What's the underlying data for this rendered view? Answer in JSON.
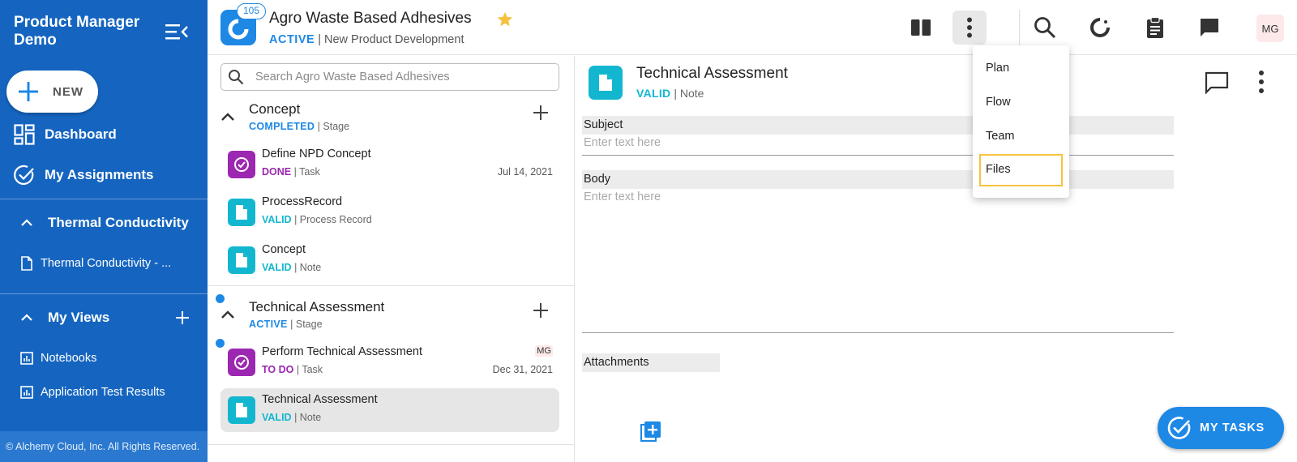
{
  "sidebar": {
    "title": "Product Manager Demo",
    "new_label": "NEW",
    "nav": [
      {
        "label": "Dashboard",
        "icon": "dashboard-icon"
      },
      {
        "label": "My Assignments",
        "icon": "check-circle-icon"
      }
    ],
    "recent_section": {
      "label": "Thermal Conductivity",
      "items": [
        {
          "label": "Thermal Conductivity - ..."
        }
      ]
    },
    "views_section": {
      "label": "My Views",
      "items": [
        {
          "label": "Notebooks"
        },
        {
          "label": "Application Test Results"
        }
      ]
    },
    "footer": "© Alchemy Cloud, Inc. All Rights Reserved."
  },
  "header": {
    "badge_count": "105",
    "title": "Agro Waste Based Adhesives",
    "status": "ACTIVE",
    "subtitle": "| New Product Development",
    "avatar": "MG"
  },
  "list": {
    "search_placeholder": "Search Agro Waste Based Adhesives",
    "stages": [
      {
        "name": "Concept",
        "status": "COMPLETED",
        "type": "Stage",
        "rows": [
          {
            "name": "Define NPD Concept",
            "status": "DONE",
            "type": "| Task",
            "date": "Jul 14, 2021"
          },
          {
            "name": "ProcessRecord",
            "status": "VALID",
            "type": "Process Record"
          },
          {
            "name": "Concept",
            "status": "VALID",
            "type": "Note"
          }
        ]
      },
      {
        "name": "Technical Assessment",
        "status": "ACTIVE",
        "type": "Stage",
        "rows": [
          {
            "name": "Perform Technical Assessment",
            "status": "TO DO",
            "type": "| Task",
            "date": "Dec 31, 2021",
            "assignee": "MG"
          },
          {
            "name": "Technical Assessment",
            "status": "VALID",
            "type": "Note"
          }
        ]
      }
    ]
  },
  "detail": {
    "title": "Technical Assessment",
    "status": "VALID",
    "type": "Note",
    "subject_label": "Subject",
    "subject_placeholder": "Enter text here",
    "body_label": "Body",
    "body_placeholder": "Enter text here",
    "attachments_label": "Attachments"
  },
  "menu": {
    "items": [
      "Plan",
      "Flow",
      "Team",
      "Files"
    ],
    "highlighted": "Files"
  },
  "my_tasks_label": "MY TASKS",
  "colors": {
    "sidebar": "#1565c0",
    "accent": "#1e88e5",
    "task": "#9c27b0",
    "note": "#12b7cf",
    "highlight": "#f6c23e"
  }
}
